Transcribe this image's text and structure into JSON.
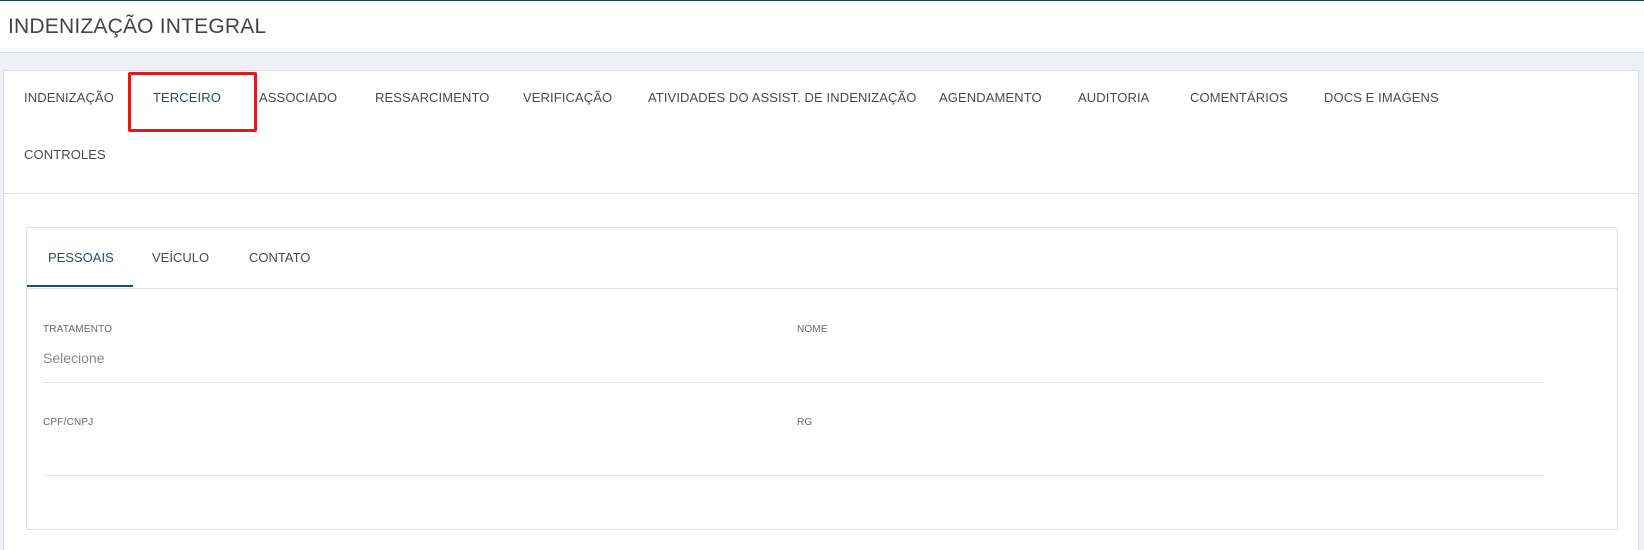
{
  "page": {
    "title": "INDENIZAÇÃO INTEGRAL"
  },
  "main_tabs": [
    {
      "label": "INDENIZAÇÃO"
    },
    {
      "label": "TERCEIRO",
      "active": true,
      "highlighted": true
    },
    {
      "label": "ASSOCIADO"
    },
    {
      "label": "RESSARCIMENTO"
    },
    {
      "label": "VERIFICAÇÃO"
    },
    {
      "label": "ATIVIDADES DO ASSIST. DE INDENIZAÇÃO"
    },
    {
      "label": "AGENDAMENTO"
    },
    {
      "label": "AUDITORIA"
    },
    {
      "label": "COMENTÁRIOS"
    },
    {
      "label": "DOCS E IMAGENS"
    },
    {
      "label": "CONTROLES"
    }
  ],
  "sub_tabs": [
    {
      "label": "PESSOAIS",
      "active": true
    },
    {
      "label": "VEÍCULO"
    },
    {
      "label": "CONTATO"
    }
  ],
  "form": {
    "tratamento": {
      "label": "TRATAMENTO",
      "value": "Selecione"
    },
    "nome": {
      "label": "NOME",
      "value": ""
    },
    "cpf_cnpj": {
      "label": "CPF/CNPJ",
      "value": ""
    },
    "rg": {
      "label": "RG",
      "value": ""
    }
  },
  "colors": {
    "accent": "#1f4e79",
    "highlight": "#e0191b",
    "background": "#eef0f5"
  }
}
